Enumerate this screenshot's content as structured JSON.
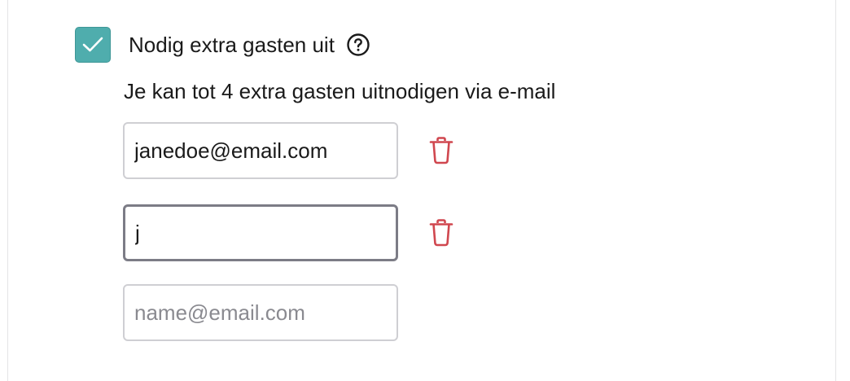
{
  "invite": {
    "checkbox_label": "Nodig extra gasten uit",
    "checked": true,
    "hint": "Je kan tot 4 extra gasten uitnodigen via e-mail"
  },
  "guests": [
    {
      "value": "janedoe@email.com",
      "placeholder": "name@email.com"
    },
    {
      "value": "j",
      "placeholder": "name@email.com"
    },
    {
      "value": "",
      "placeholder": "name@email.com"
    }
  ],
  "icons": {
    "check": "check-icon",
    "help": "question-circle-icon",
    "delete": "trash-icon"
  },
  "colors": {
    "accent": "#4fadad",
    "danger": "#d0474f",
    "text": "#1a1a1a",
    "placeholder": "#8a8a90"
  }
}
